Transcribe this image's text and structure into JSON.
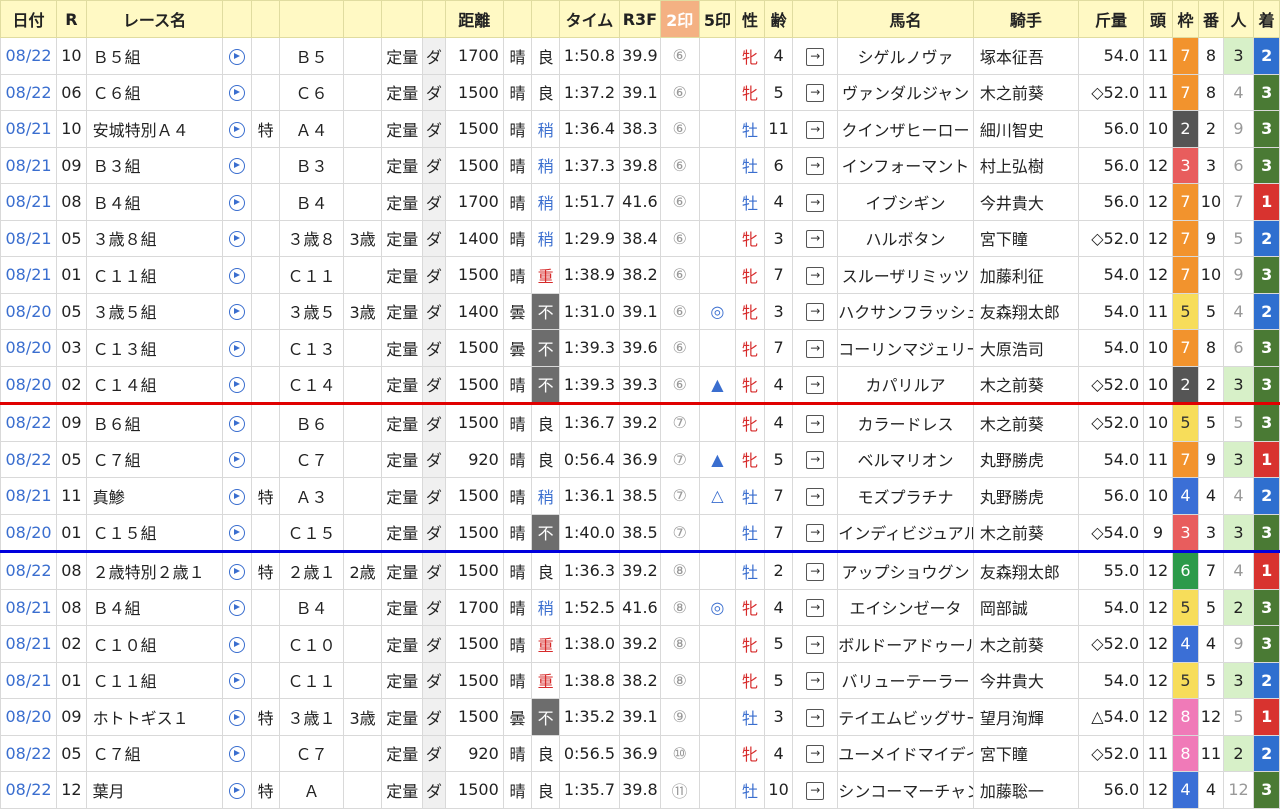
{
  "headers": {
    "date": "日付",
    "r": "R",
    "race": "レース名",
    "dist": "距離",
    "time": "タイム",
    "r3f": "R3F",
    "m2": "2印",
    "m5": "5印",
    "sex": "性",
    "age": "齢",
    "horse": "馬名",
    "jockey": "騎手",
    "weight": "斤量",
    "heads": "頭",
    "frame": "枠",
    "num": "番",
    "pop": "人",
    "finish": "着"
  },
  "colors": {
    "header_bg": "#fff9c4",
    "header_2in": "#f4b183",
    "link": "#3a6ecf",
    "red_separator": "#e00000",
    "blue_separator": "#0000dd"
  },
  "rows": [
    {
      "date": "08/22",
      "r": "10",
      "name": "Ｂ５組",
      "special": "",
      "cls": "Ｂ５",
      "age_cond": "",
      "cond": "定量",
      "surf": "ダ",
      "dist": "1700",
      "weather": "晴",
      "track": "良",
      "time": "1:50.8",
      "r3f": "39.9",
      "m2": "⑥",
      "m5": "",
      "sex": "牝",
      "age": "4",
      "horse": "シゲルノヴァ",
      "jockey": "塚本征吾",
      "weight": "54.0",
      "heads": "11",
      "frame": "7",
      "num": "8",
      "pop": "3",
      "finish": "2"
    },
    {
      "date": "08/22",
      "r": "06",
      "name": "Ｃ６組",
      "special": "",
      "cls": "Ｃ６",
      "age_cond": "",
      "cond": "定量",
      "surf": "ダ",
      "dist": "1500",
      "weather": "晴",
      "track": "良",
      "time": "1:37.2",
      "r3f": "39.1",
      "m2": "⑥",
      "m5": "",
      "sex": "牝",
      "age": "5",
      "horse": "ヴァンダルジャン",
      "jockey": "木之前葵",
      "weight": "◇52.0",
      "heads": "11",
      "frame": "7",
      "num": "8",
      "pop": "4",
      "finish": "3"
    },
    {
      "date": "08/21",
      "r": "10",
      "name": "安城特別Ａ４",
      "special": "特",
      "cls": "Ａ４",
      "age_cond": "",
      "cond": "定量",
      "surf": "ダ",
      "dist": "1500",
      "weather": "晴",
      "track": "稍",
      "time": "1:36.4",
      "r3f": "38.3",
      "m2": "⑥",
      "m5": "",
      "sex": "牡",
      "age": "11",
      "horse": "クインザヒーロー",
      "jockey": "細川智史",
      "weight": "56.0",
      "heads": "10",
      "frame": "2",
      "num": "2",
      "pop": "9",
      "finish": "3"
    },
    {
      "date": "08/21",
      "r": "09",
      "name": "Ｂ３組",
      "special": "",
      "cls": "Ｂ３",
      "age_cond": "",
      "cond": "定量",
      "surf": "ダ",
      "dist": "1500",
      "weather": "晴",
      "track": "稍",
      "time": "1:37.3",
      "r3f": "39.8",
      "m2": "⑥",
      "m5": "",
      "sex": "牡",
      "age": "6",
      "horse": "インフォーマント",
      "jockey": "村上弘樹",
      "weight": "56.0",
      "heads": "12",
      "frame": "3",
      "num": "3",
      "pop": "6",
      "finish": "3"
    },
    {
      "date": "08/21",
      "r": "08",
      "name": "Ｂ４組",
      "special": "",
      "cls": "Ｂ４",
      "age_cond": "",
      "cond": "定量",
      "surf": "ダ",
      "dist": "1700",
      "weather": "晴",
      "track": "稍",
      "time": "1:51.7",
      "r3f": "41.6",
      "m2": "⑥",
      "m5": "",
      "sex": "牡",
      "age": "4",
      "horse": "イブシギン",
      "jockey": "今井貴大",
      "weight": "56.0",
      "heads": "12",
      "frame": "7",
      "num": "10",
      "pop": "7",
      "finish": "1"
    },
    {
      "date": "08/21",
      "r": "05",
      "name": "３歳８組",
      "special": "",
      "cls": "３歳８",
      "age_cond": "3歳",
      "cond": "定量",
      "surf": "ダ",
      "dist": "1400",
      "weather": "晴",
      "track": "稍",
      "time": "1:29.9",
      "r3f": "38.4",
      "m2": "⑥",
      "m5": "",
      "sex": "牝",
      "age": "3",
      "horse": "ハルボタン",
      "jockey": "宮下瞳",
      "weight": "◇52.0",
      "heads": "12",
      "frame": "7",
      "num": "9",
      "pop": "5",
      "finish": "2"
    },
    {
      "date": "08/21",
      "r": "01",
      "name": "Ｃ１１組",
      "special": "",
      "cls": "Ｃ１１",
      "age_cond": "",
      "cond": "定量",
      "surf": "ダ",
      "dist": "1500",
      "weather": "晴",
      "track": "重",
      "time": "1:38.9",
      "r3f": "38.2",
      "m2": "⑥",
      "m5": "",
      "sex": "牝",
      "age": "7",
      "horse": "スルーザリミッツ",
      "jockey": "加藤利征",
      "weight": "54.0",
      "heads": "12",
      "frame": "7",
      "num": "10",
      "pop": "9",
      "finish": "3"
    },
    {
      "date": "08/20",
      "r": "05",
      "name": "３歳５組",
      "special": "",
      "cls": "３歳５",
      "age_cond": "3歳",
      "cond": "定量",
      "surf": "ダ",
      "dist": "1400",
      "weather": "曇",
      "track": "不",
      "time": "1:31.0",
      "r3f": "39.1",
      "m2": "⑥",
      "m5": "◎",
      "sex": "牝",
      "age": "3",
      "horse": "ハクサンフラッシュ",
      "jockey": "友森翔太郎",
      "weight": "54.0",
      "heads": "11",
      "frame": "5",
      "num": "5",
      "pop": "4",
      "finish": "2"
    },
    {
      "date": "08/20",
      "r": "03",
      "name": "Ｃ１３組",
      "special": "",
      "cls": "Ｃ１３",
      "age_cond": "",
      "cond": "定量",
      "surf": "ダ",
      "dist": "1500",
      "weather": "曇",
      "track": "不",
      "time": "1:39.3",
      "r3f": "39.6",
      "m2": "⑥",
      "m5": "",
      "sex": "牝",
      "age": "7",
      "horse": "コーリンマジェリー",
      "jockey": "大原浩司",
      "weight": "54.0",
      "heads": "10",
      "frame": "7",
      "num": "8",
      "pop": "6",
      "finish": "3"
    },
    {
      "date": "08/20",
      "r": "02",
      "name": "Ｃ１４組",
      "special": "",
      "cls": "Ｃ１４",
      "age_cond": "",
      "cond": "定量",
      "surf": "ダ",
      "dist": "1500",
      "weather": "晴",
      "track": "不",
      "time": "1:39.3",
      "r3f": "39.3",
      "m2": "⑥",
      "m5": "▲",
      "sex": "牝",
      "age": "4",
      "horse": "カパリルア",
      "jockey": "木之前葵",
      "weight": "◇52.0",
      "heads": "10",
      "frame": "2",
      "num": "2",
      "pop": "3",
      "finish": "3"
    },
    {
      "date": "08/22",
      "r": "09",
      "name": "Ｂ６組",
      "special": "",
      "cls": "Ｂ６",
      "age_cond": "",
      "cond": "定量",
      "surf": "ダ",
      "dist": "1500",
      "weather": "晴",
      "track": "良",
      "time": "1:36.7",
      "r3f": "39.2",
      "m2": "⑦",
      "m5": "",
      "sex": "牝",
      "age": "4",
      "horse": "カラードレス",
      "jockey": "木之前葵",
      "weight": "◇52.0",
      "heads": "10",
      "frame": "5",
      "num": "5",
      "pop": "5",
      "finish": "3"
    },
    {
      "date": "08/22",
      "r": "05",
      "name": "Ｃ７組",
      "special": "",
      "cls": "Ｃ７",
      "age_cond": "",
      "cond": "定量",
      "surf": "ダ",
      "dist": "920",
      "weather": "晴",
      "track": "良",
      "time": "0:56.4",
      "r3f": "36.9",
      "m2": "⑦",
      "m5": "▲",
      "sex": "牝",
      "age": "5",
      "horse": "ベルマリオン",
      "jockey": "丸野勝虎",
      "weight": "54.0",
      "heads": "11",
      "frame": "7",
      "num": "9",
      "pop": "3",
      "finish": "1"
    },
    {
      "date": "08/21",
      "r": "11",
      "name": "真鯵",
      "special": "特",
      "cls": "Ａ３",
      "age_cond": "",
      "cond": "定量",
      "surf": "ダ",
      "dist": "1500",
      "weather": "晴",
      "track": "稍",
      "time": "1:36.1",
      "r3f": "38.5",
      "m2": "⑦",
      "m5": "△",
      "sex": "牡",
      "age": "7",
      "horse": "モズプラチナ",
      "jockey": "丸野勝虎",
      "weight": "56.0",
      "heads": "10",
      "frame": "4",
      "num": "4",
      "pop": "4",
      "finish": "2"
    },
    {
      "date": "08/20",
      "r": "01",
      "name": "Ｃ１５組",
      "special": "",
      "cls": "Ｃ１５",
      "age_cond": "",
      "cond": "定量",
      "surf": "ダ",
      "dist": "1500",
      "weather": "晴",
      "track": "不",
      "time": "1:40.0",
      "r3f": "38.5",
      "m2": "⑦",
      "m5": "",
      "sex": "牡",
      "age": "7",
      "horse": "インディビジュアル",
      "jockey": "木之前葵",
      "weight": "◇54.0",
      "heads": "9",
      "frame": "3",
      "num": "3",
      "pop": "3",
      "finish": "3"
    },
    {
      "date": "08/22",
      "r": "08",
      "name": "２歳特別２歳１",
      "special": "特",
      "cls": "２歳１",
      "age_cond": "2歳",
      "cond": "定量",
      "surf": "ダ",
      "dist": "1500",
      "weather": "晴",
      "track": "良",
      "time": "1:36.3",
      "r3f": "39.2",
      "m2": "⑧",
      "m5": "",
      "sex": "牡",
      "age": "2",
      "horse": "アップショウグン",
      "jockey": "友森翔太郎",
      "weight": "55.0",
      "heads": "12",
      "frame": "6",
      "num": "7",
      "pop": "4",
      "finish": "1"
    },
    {
      "date": "08/21",
      "r": "08",
      "name": "Ｂ４組",
      "special": "",
      "cls": "Ｂ４",
      "age_cond": "",
      "cond": "定量",
      "surf": "ダ",
      "dist": "1700",
      "weather": "晴",
      "track": "稍",
      "time": "1:52.5",
      "r3f": "41.6",
      "m2": "⑧",
      "m5": "◎",
      "sex": "牝",
      "age": "4",
      "horse": "エイシンゼータ",
      "jockey": "岡部誠",
      "weight": "54.0",
      "heads": "12",
      "frame": "5",
      "num": "5",
      "pop": "2",
      "finish": "3"
    },
    {
      "date": "08/21",
      "r": "02",
      "name": "Ｃ１０組",
      "special": "",
      "cls": "Ｃ１０",
      "age_cond": "",
      "cond": "定量",
      "surf": "ダ",
      "dist": "1500",
      "weather": "晴",
      "track": "重",
      "time": "1:38.0",
      "r3f": "39.2",
      "m2": "⑧",
      "m5": "",
      "sex": "牝",
      "age": "5",
      "horse": "ボルドーアドゥール",
      "jockey": "木之前葵",
      "weight": "◇52.0",
      "heads": "12",
      "frame": "4",
      "num": "4",
      "pop": "9",
      "finish": "3"
    },
    {
      "date": "08/21",
      "r": "01",
      "name": "Ｃ１１組",
      "special": "",
      "cls": "Ｃ１１",
      "age_cond": "",
      "cond": "定量",
      "surf": "ダ",
      "dist": "1500",
      "weather": "晴",
      "track": "重",
      "time": "1:38.8",
      "r3f": "38.2",
      "m2": "⑧",
      "m5": "",
      "sex": "牝",
      "age": "5",
      "horse": "バリューテーラー",
      "jockey": "今井貴大",
      "weight": "54.0",
      "heads": "12",
      "frame": "5",
      "num": "5",
      "pop": "3",
      "finish": "2"
    },
    {
      "date": "08/20",
      "r": "09",
      "name": "ホトトギス１",
      "special": "特",
      "cls": "３歳１",
      "age_cond": "3歳",
      "cond": "定量",
      "surf": "ダ",
      "dist": "1500",
      "weather": "曇",
      "track": "不",
      "time": "1:35.2",
      "r3f": "39.1",
      "m2": "⑨",
      "m5": "",
      "sex": "牡",
      "age": "3",
      "horse": "テイエムビッグサー",
      "jockey": "望月洵輝",
      "weight": "△54.0",
      "heads": "12",
      "frame": "8",
      "num": "12",
      "pop": "5",
      "finish": "1"
    },
    {
      "date": "08/22",
      "r": "05",
      "name": "Ｃ７組",
      "special": "",
      "cls": "Ｃ７",
      "age_cond": "",
      "cond": "定量",
      "surf": "ダ",
      "dist": "920",
      "weather": "晴",
      "track": "良",
      "time": "0:56.5",
      "r3f": "36.9",
      "m2": "⑩",
      "m5": "",
      "sex": "牝",
      "age": "4",
      "horse": "ユーメイドマイデイ",
      "jockey": "宮下瞳",
      "weight": "◇52.0",
      "heads": "11",
      "frame": "8",
      "num": "11",
      "pop": "2",
      "finish": "2"
    },
    {
      "date": "08/22",
      "r": "12",
      "name": "葉月",
      "special": "特",
      "cls": "Ａ",
      "age_cond": "",
      "cond": "定量",
      "surf": "ダ",
      "dist": "1500",
      "weather": "晴",
      "track": "良",
      "time": "1:35.7",
      "r3f": "39.8",
      "m2": "⑪",
      "m5": "",
      "sex": "牡",
      "age": "10",
      "horse": "シンコーマーチャン",
      "jockey": "加藤聡一",
      "weight": "56.0",
      "heads": "12",
      "frame": "4",
      "num": "4",
      "pop": "12",
      "finish": "3"
    }
  ]
}
